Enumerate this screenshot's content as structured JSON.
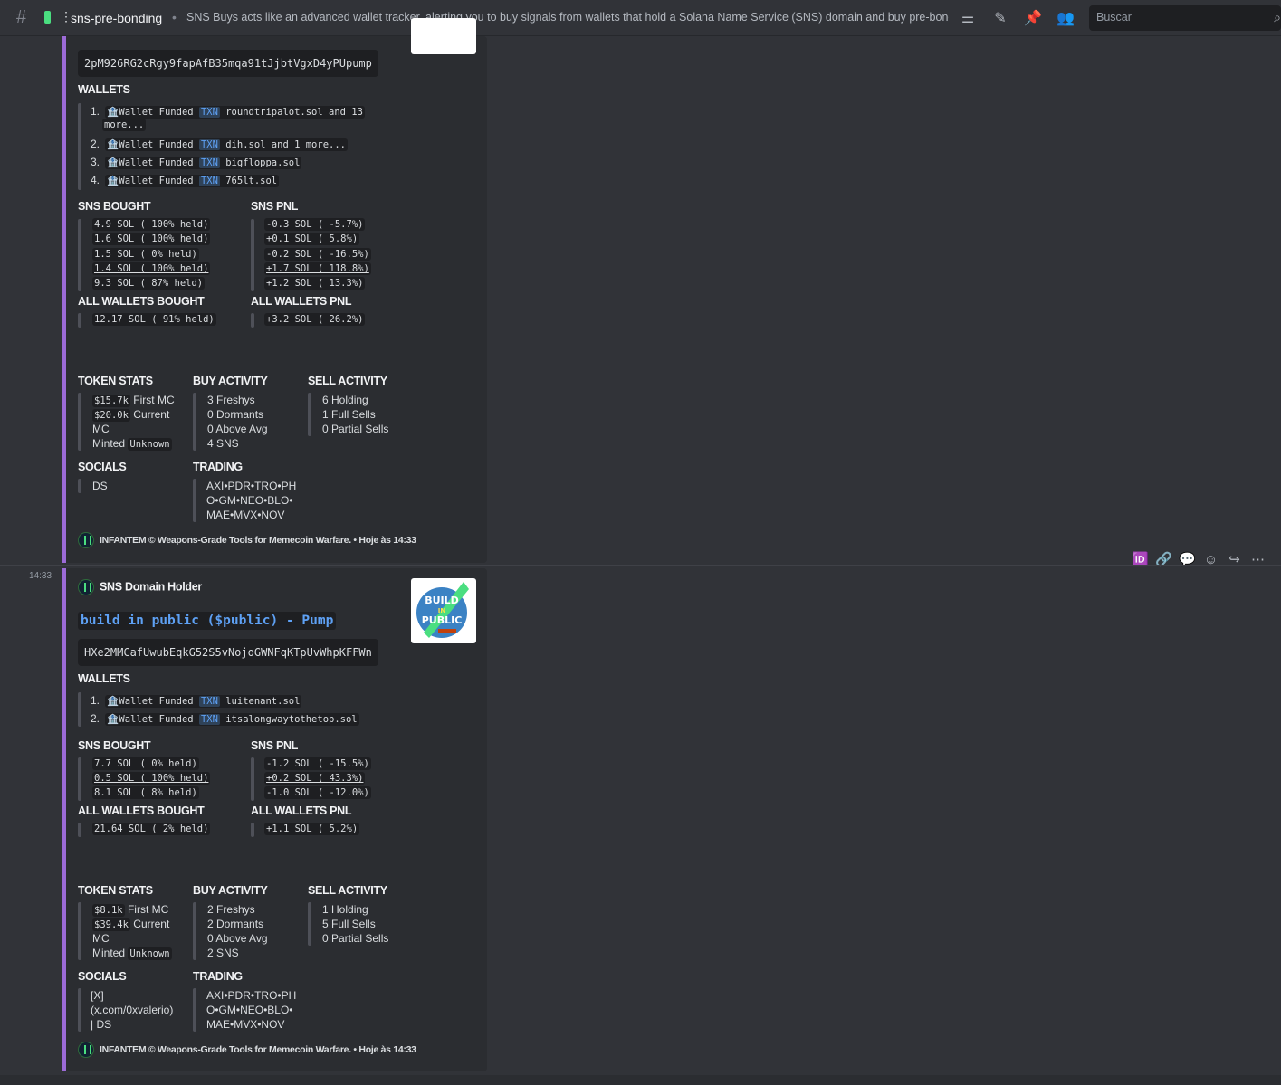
{
  "header": {
    "channel": "sns-pre-bonding",
    "topic": "SNS Buys acts like an advanced wallet tracker, alerting you to buy signals from wallets that hold a Solana Name Service (SNS) domain and buy pre-bondin...",
    "search_placeholder": "Buscar"
  },
  "messages": [
    {
      "contract": "2pM926RG2cRgy9fapAfB35mqa91tJjbtVgxD4yPUpump",
      "wallets_title": "WALLETS",
      "wallets": [
        {
          "n": "1.",
          "text": "🏦Wallet Funded",
          "txn": "TXN",
          "who": "roundtripalot.sol and 13",
          "more": "more..."
        },
        {
          "n": "2.",
          "text": "🏦Wallet Funded",
          "txn": "TXN",
          "who": "dih.sol and 1 more..."
        },
        {
          "n": "3.",
          "text": "🏦Wallet Funded",
          "txn": "TXN",
          "who": "bigfloppa.sol"
        },
        {
          "n": "4.",
          "text": "🏦Wallet Funded",
          "txn": "TXN",
          "who": "765lt.sol"
        }
      ],
      "sns_bought_title": "SNS BOUGHT",
      "sns_bought": [
        "4.9 SOL ( 100% held)",
        "1.6 SOL ( 100% held)",
        "1.5 SOL ( 0% held)",
        "1.4 SOL ( 100% held)",
        "9.3 SOL ( 87% held)"
      ],
      "sns_pnl_title": "SNS PNL",
      "sns_pnl": [
        "-0.3 SOL ( -5.7%)",
        "+0.1 SOL ( 5.8%)",
        "-0.2 SOL ( -16.5%)",
        "+1.7 SOL ( 118.8%)",
        "+1.2 SOL ( 13.3%)"
      ],
      "all_bought_title": "ALL WALLETS BOUGHT",
      "all_bought": "12.17 SOL ( 91% held)",
      "all_pnl_title": "ALL WALLETS PNL",
      "all_pnl": "+3.2 SOL ( 26.2%)",
      "token_stats_title": "TOKEN STATS",
      "first_mc": "$15.7k",
      "first_mc_label": "First MC",
      "current_mc": "$20.0k",
      "current_mc_label": "Current",
      "mc_label": "MC",
      "minted_label": "Minted",
      "minted": "Unknown",
      "buy_activity_title": "BUY ACTIVITY",
      "buy_activity": [
        "3 Freshys",
        "0 Dormants",
        "0 Above Avg",
        "4 SNS"
      ],
      "sell_activity_title": "SELL ACTIVITY",
      "sell_activity": [
        "6 Holding",
        "1 Full Sells",
        "0 Partial Sells"
      ],
      "socials_title": "SOCIALS",
      "socials": [
        "DS"
      ],
      "trading_title": "TRADING",
      "trading": [
        "AXI•PDR•TRO•PH",
        "O•GM•NEO•BLO•",
        "MAE•MVX•NOV"
      ],
      "footer": "INFANTEM © Weapons-Grade Tools for Memecoin Warfare. • Hoje às 14:33"
    },
    {
      "time": "14:33",
      "author": "SNS Domain Holder",
      "token_title": "build in public ($public) - Pump",
      "thumb_text": "BUILD IN PUBLIC",
      "contract": "HXe2MMCafUwubEqkG52S5vNojoGWNFqKTpUvWhpKFFWn",
      "wallets_title": "WALLETS",
      "wallets": [
        {
          "n": "1.",
          "text": "🏦Wallet Funded",
          "txn": "TXN",
          "who": "luitenant.sol"
        },
        {
          "n": "2.",
          "text": "🏦Wallet Funded",
          "txn": "TXN",
          "who": "itsalongwaytothetop.sol"
        }
      ],
      "sns_bought_title": "SNS BOUGHT",
      "sns_bought": [
        "7.7 SOL ( 0% held)",
        "0.5 SOL ( 100% held)",
        "8.1 SOL ( 8% held)"
      ],
      "sns_pnl_title": "SNS PNL",
      "sns_pnl": [
        "-1.2 SOL ( -15.5%)",
        "+0.2 SOL ( 43.3%)",
        "-1.0 SOL ( -12.0%)"
      ],
      "all_bought_title": "ALL WALLETS BOUGHT",
      "all_bought": "21.64 SOL ( 2% held)",
      "all_pnl_title": "ALL WALLETS PNL",
      "all_pnl": "+1.1 SOL ( 5.2%)",
      "token_stats_title": "TOKEN STATS",
      "first_mc": "$8.1k",
      "first_mc_label": "First MC",
      "current_mc": "$39.4k",
      "current_mc_label": "Current",
      "mc_label": "MC",
      "minted_label": "Minted",
      "minted": "Unknown",
      "buy_activity_title": "BUY ACTIVITY",
      "buy_activity": [
        "2 Freshys",
        "2 Dormants",
        "0 Above Avg",
        "2 SNS"
      ],
      "sell_activity_title": "SELL ACTIVITY",
      "sell_activity": [
        "1 Holding",
        "5 Full Sells",
        "0 Partial Sells"
      ],
      "socials_title": "SOCIALS",
      "socials": [
        "[X]",
        "(x.com/0xvalerio)",
        "| DS"
      ],
      "trading_title": "TRADING",
      "trading": [
        "AXI•PDR•TRO•PH",
        "O•GM•NEO•BLO•",
        "MAE•MVX•NOV"
      ],
      "footer": "INFANTEM © Weapons-Grade Tools for Memecoin Warfare. • Hoje às 14:33"
    }
  ],
  "colors": {
    "accent": "#9c6bd7",
    "link": "#5ea1f5",
    "positive": "#4ade80",
    "negative": "#f87171"
  }
}
